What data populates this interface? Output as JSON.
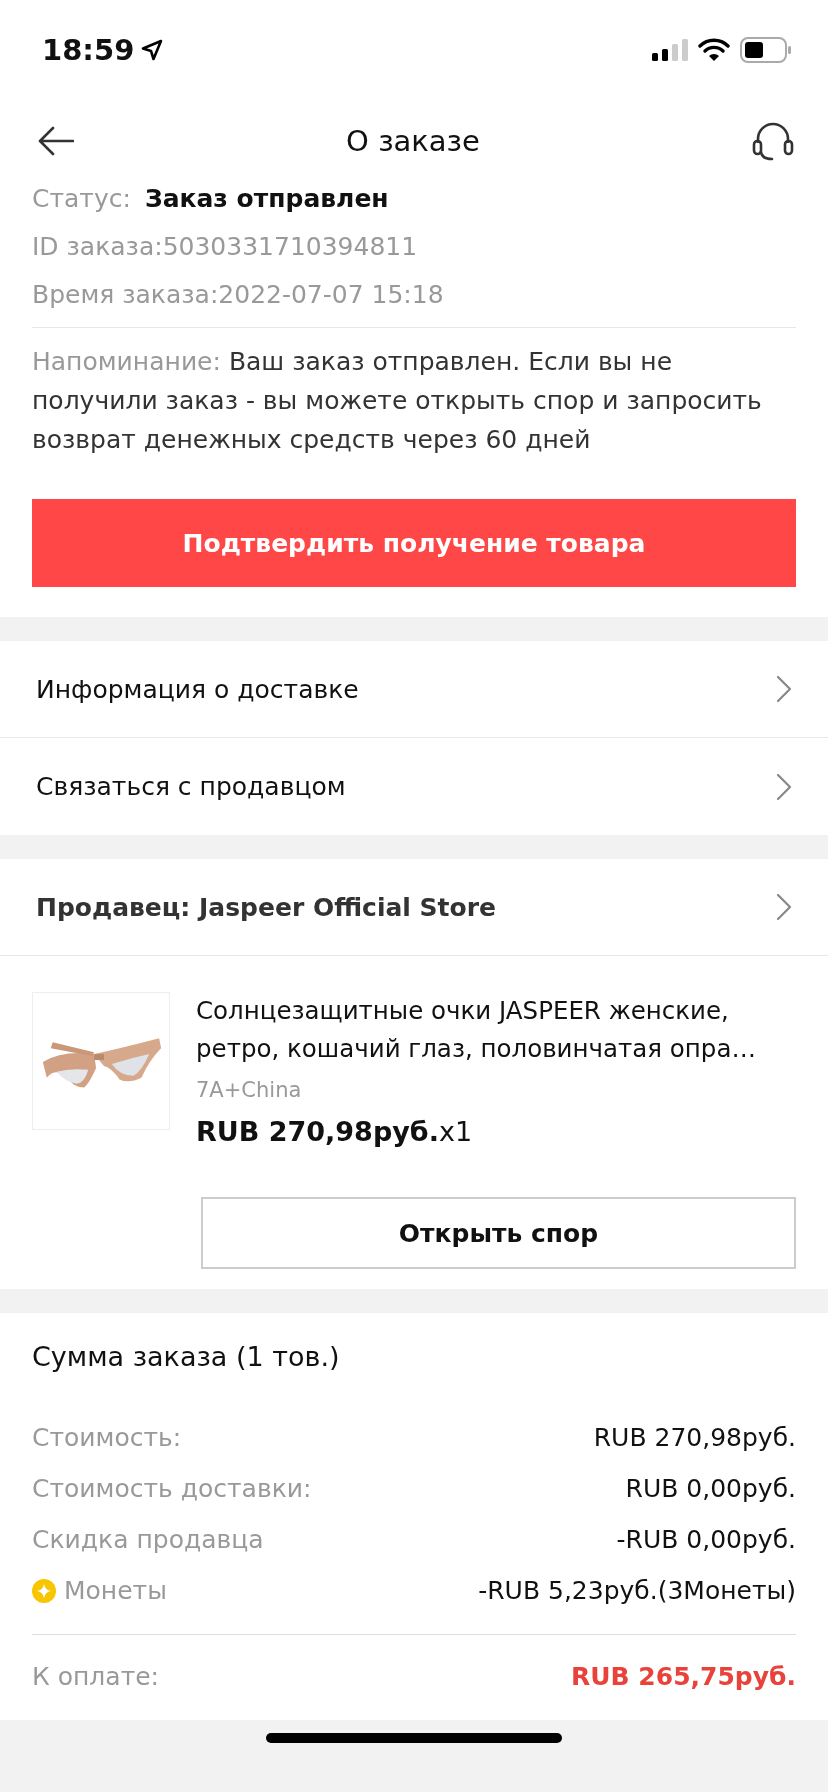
{
  "status_bar": {
    "time": "18:59"
  },
  "header": {
    "title": "О заказе"
  },
  "order": {
    "status_label": "Статус:",
    "status_value": "Заказ отправлен",
    "id": "ID заказа:5030331710394811",
    "time": "Время заказа:2022-07-07 15:18",
    "reminder_label": "Напоминание:",
    "reminder_text": "Ваш заказ отправлен. Если вы не получили заказ - вы можете открыть спор и запросить возврат денежных средств через 60 дней"
  },
  "confirm_button": "Подтвердить получение товара",
  "links": [
    {
      "label": "Информация о доставке"
    },
    {
      "label": "Связаться с продавцом"
    }
  ],
  "seller": "Продавец: Jaspeer Official Store",
  "product": {
    "title": "Солнцезащитные очки JASPEER женские, ретро, кошачий глаз, половинчатая опра…",
    "variant": "7A+China",
    "price": "RUB 270,98руб.",
    "quantity": "x1"
  },
  "dispute_button": "Открыть спор",
  "summary": {
    "title": "Сумма заказа (1 тов.)",
    "rows": [
      {
        "kind": "plain",
        "label": "Стоимость:",
        "value": "RUB 270,98руб."
      },
      {
        "kind": "plain",
        "label": "Стоимость доставки:",
        "value": "RUB 0,00руб."
      },
      {
        "kind": "plain",
        "label": "Скидка продавца",
        "value": "-RUB 0,00руб."
      },
      {
        "kind": "coins",
        "label": "Монеты",
        "value": "-RUB 5,23руб.(3Монеты)"
      }
    ],
    "total_label": "К оплате:",
    "total_value": "RUB 265,75руб."
  }
}
